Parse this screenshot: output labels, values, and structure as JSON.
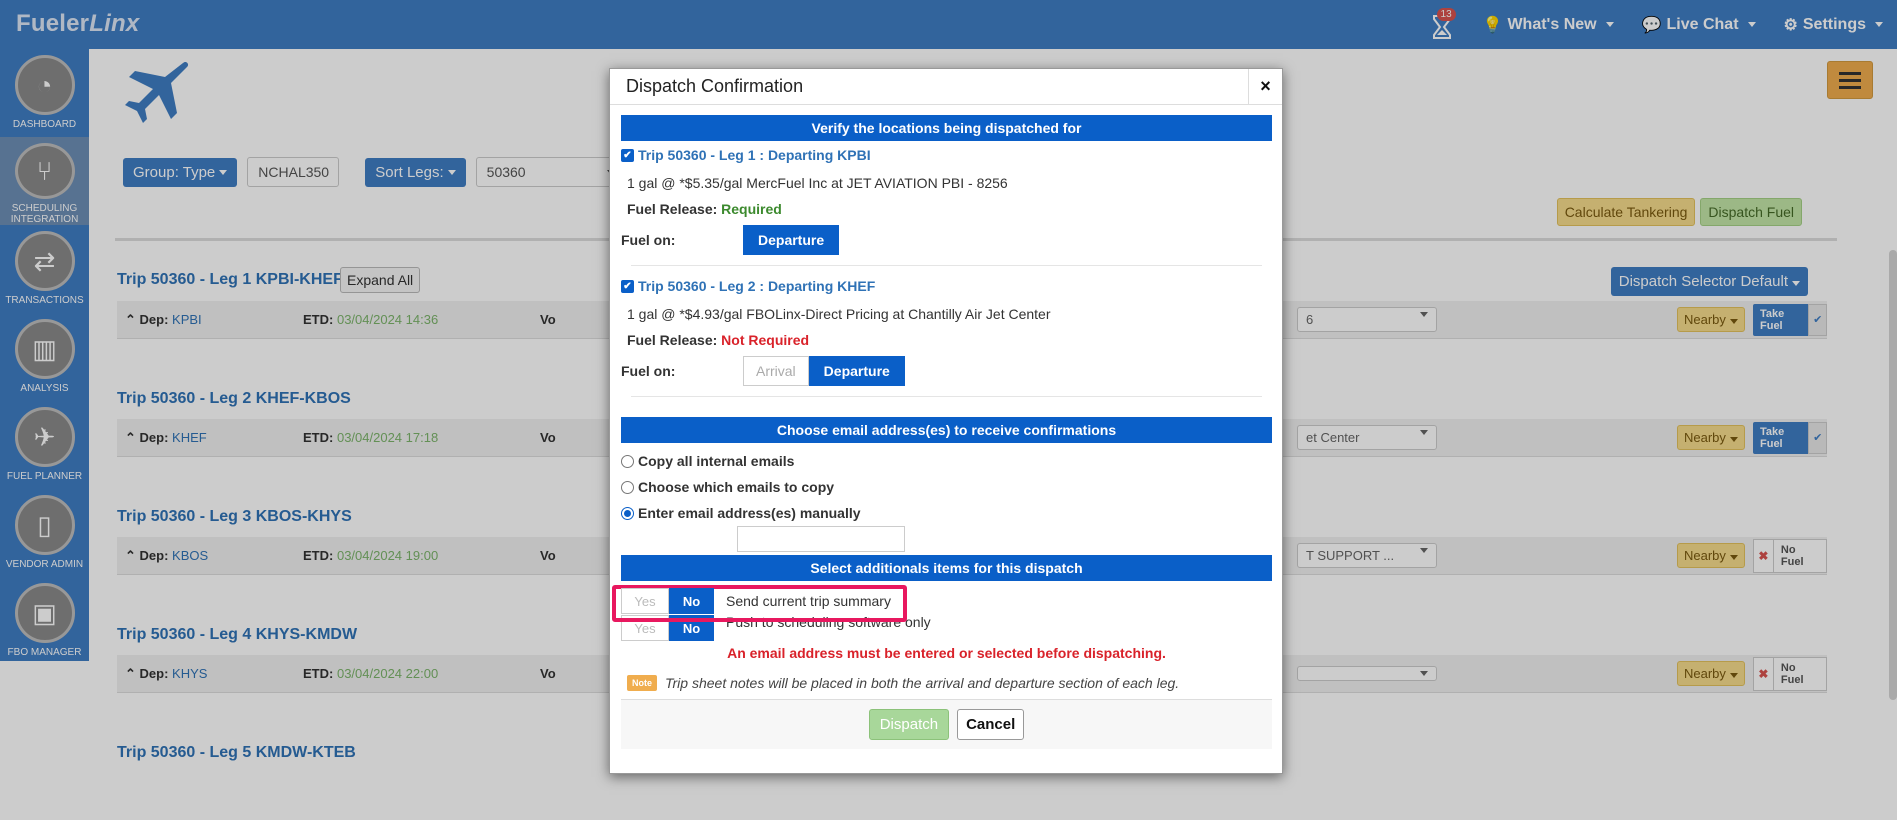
{
  "app": {
    "logo_main": "Fueler",
    "logo_italic": "Linx"
  },
  "topnav": {
    "badge_count": "13",
    "whats_new": "What's New",
    "live_chat": "Live Chat",
    "settings": "Settings"
  },
  "sidebar": {
    "items": [
      {
        "label": "DASHBOARD",
        "icon": "gauge-icon"
      },
      {
        "label": "SCHEDULING INTEGRATION",
        "icon": "branch-icon"
      },
      {
        "label": "TRANSACTIONS",
        "icon": "swap-icon"
      },
      {
        "label": "ANALYSIS",
        "icon": "bar-chart-icon"
      },
      {
        "label": "FUEL PLANNER",
        "icon": "plane-icon"
      },
      {
        "label": "VENDOR ADMIN",
        "icon": "document-icon"
      },
      {
        "label": "FBO MANAGER",
        "icon": "briefcase-icon"
      }
    ]
  },
  "filters": {
    "group_label": "Group: Type",
    "group_value": "NCHAL350",
    "sort_label": "Sort Legs:",
    "sort_value": "50360"
  },
  "actions": {
    "calc_tankering": "Calculate Tankering",
    "dispatch_fuel": "Dispatch Fuel",
    "expand_all": "Expand All",
    "dispatch_selector": "Dispatch Selector Default"
  },
  "legs": [
    {
      "title": "Trip 50360 - Leg 1 KPBI-KHEF",
      "dep_label": "Dep:",
      "dep": "KPBI",
      "etd_label": "ETD:",
      "etd": "03/04/2024 14:36",
      "vo": "Vo",
      "fbo": "6",
      "nearby": "Nearby",
      "fuel": "Take Fuel",
      "take": true
    },
    {
      "title": "Trip 50360 - Leg 2 KHEF-KBOS",
      "dep_label": "Dep:",
      "dep": "KHEF",
      "etd_label": "ETD:",
      "etd": "03/04/2024 17:18",
      "vo": "Vo",
      "fbo": "et Center",
      "nearby": "Nearby",
      "fuel": "Take Fuel",
      "take": true
    },
    {
      "title": "Trip 50360 - Leg 3 KBOS-KHYS",
      "dep_label": "Dep:",
      "dep": "KBOS",
      "etd_label": "ETD:",
      "etd": "03/04/2024 19:00",
      "vo": "Vo",
      "fbo": "T SUPPORT ...",
      "nearby": "Nearby",
      "fuel": "No Fuel",
      "take": false
    },
    {
      "title": "Trip 50360 - Leg 4 KHYS-KMDW",
      "dep_label": "Dep:",
      "dep": "KHYS",
      "etd_label": "ETD:",
      "etd": "03/04/2024 22:00",
      "vo": "Vo",
      "fbo": "",
      "nearby": "Nearby",
      "fuel": "No Fuel",
      "take": false
    },
    {
      "title": "Trip 50360 - Leg 5 KMDW-KTEB"
    }
  ],
  "modal": {
    "title": "Dispatch Confirmation",
    "close": "×",
    "verify_header": "Verify the locations being dispatched for",
    "dispatch_legs": [
      {
        "title": "Trip 50360 - Leg 1 : Departing KPBI",
        "price_line": "1 gal @ *$5.35/gal MercFuel Inc at JET AVIATION PBI - 8256",
        "fuel_release_label": "Fuel Release:",
        "fuel_release_value": "Required",
        "fuel_on_label": "Fuel on:",
        "departure": "Departure"
      },
      {
        "title": "Trip 50360 - Leg 2 : Departing KHEF",
        "price_line": "1 gal @ *$4.93/gal FBOLinx-Direct Pricing at Chantilly Air Jet Center",
        "fuel_release_label": "Fuel Release:",
        "fuel_release_value": "Not Required",
        "fuel_on_label": "Fuel on:",
        "arrival": "Arrival",
        "departure": "Departure"
      }
    ],
    "email_header": "Choose email address(es) to receive confirmations",
    "email_options": [
      "Copy all internal emails",
      "Choose which emails to copy",
      "Enter email address(es) manually"
    ],
    "email_value": "",
    "additional_header": "Select additionals items for this dispatch",
    "toggle_yes": "Yes",
    "toggle_no": "No",
    "option_summary": "Send current trip summary",
    "option_push": "Push to scheduling software only",
    "error": "An email address must be entered or selected before dispatching.",
    "note_badge": "Note",
    "note_text": "Trip sheet notes will be placed in both the arrival and departure section of each leg.",
    "dispatch_btn": "Dispatch",
    "cancel_btn": "Cancel"
  }
}
